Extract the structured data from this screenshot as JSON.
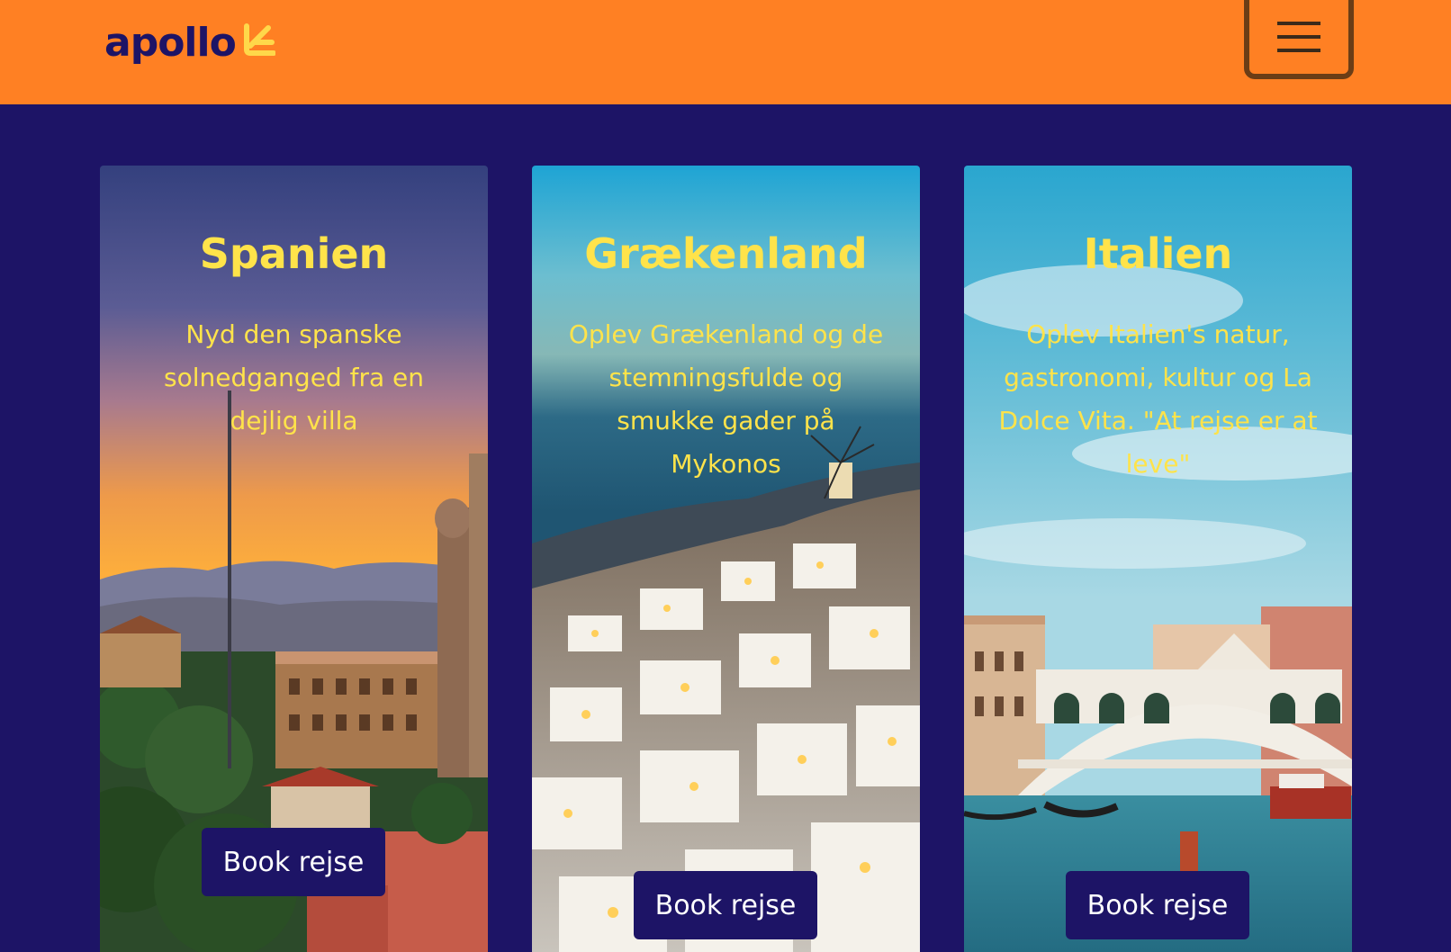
{
  "navbar": {
    "logo_text": "apollo",
    "logo_icon": "apollo-sun-icon",
    "menu_icon": "hamburger-menu-icon",
    "background_color": "#ff8023"
  },
  "page": {
    "background_color": "#1d1466",
    "accent_color": "#ffe34a"
  },
  "cards": [
    {
      "title": "Spanien",
      "text": "Nyd den spanske solnedganged fra en dejlig villa",
      "button_label": "Book rejse",
      "image": "barcelona-sunset-photo"
    },
    {
      "title": "Grækenland",
      "text": "Oplev Grækenland og de stemningsfulde og smukke gader på Mykonos",
      "button_label": "Book rejse",
      "image": "mykonos-village-night-photo"
    },
    {
      "title": "Italien",
      "text": "Oplev Italien's natur, gastronomi, kultur og La Dolce Vita. \"At rejse er at leve\"",
      "button_label": "Book rejse",
      "image": "venice-rialto-bridge-photo"
    }
  ]
}
